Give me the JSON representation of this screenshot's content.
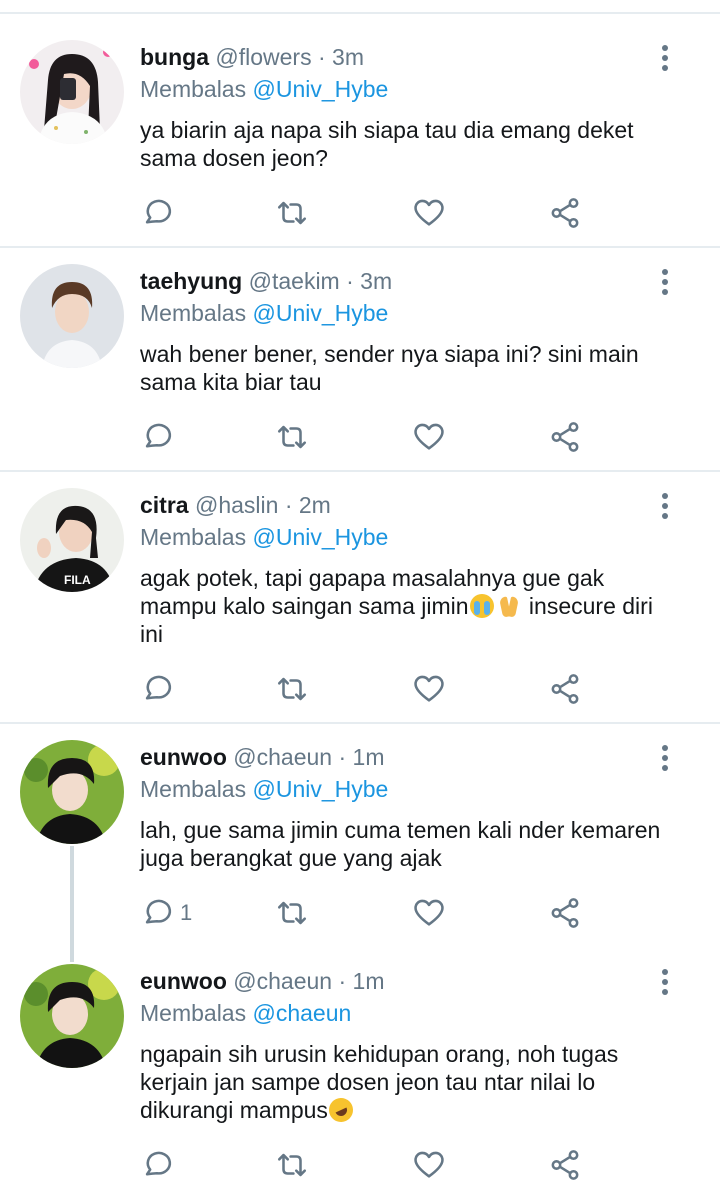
{
  "tweets": [
    {
      "name": "bunga",
      "handle": "@flowers",
      "dot": "·",
      "time": "3m",
      "reply_prefix": "Membalas",
      "reply_to": "@Univ_Hybe",
      "text": "ya biarin aja napa sih siapa tau dia emang deket sama dosen jeon?",
      "reply_count": ""
    },
    {
      "name": "taehyung",
      "handle": "@taekim",
      "dot": "·",
      "time": "3m",
      "reply_prefix": "Membalas",
      "reply_to": "@Univ_Hybe",
      "text": "wah bener bener, sender nya siapa ini? sini main sama kita biar tau",
      "reply_count": ""
    },
    {
      "name": "citra",
      "handle": "@haslin",
      "dot": "·",
      "time": "2m",
      "reply_prefix": "Membalas",
      "reply_to": "@Univ_Hybe",
      "text_before": "agak potek, tapi gapapa masalahnya gue gak mampu kalo saingan sama jimin",
      "text_after": " insecure diri ini",
      "emojis": [
        "loudly-crying-face",
        "folded-hands"
      ],
      "reply_count": ""
    },
    {
      "name": "eunwoo",
      "handle": "@chaeun",
      "dot": "·",
      "time": "1m",
      "reply_prefix": "Membalas",
      "reply_to": "@Univ_Hybe",
      "text": "lah, gue sama jimin cuma temen kali nder kemaren juga berangkat gue yang ajak",
      "reply_count": "1"
    },
    {
      "name": "eunwoo",
      "handle": "@chaeun",
      "dot": "·",
      "time": "1m",
      "reply_prefix": "Membalas",
      "reply_to": "@chaeun",
      "text_before": "ngapain sih urusin kehidupan orang, noh tugas kerjain jan sampe dosen jeon tau ntar nilai lo dikurangi mampus",
      "emojis": [
        "rolling-on-floor-laughing"
      ],
      "reply_count": ""
    }
  ],
  "icons": {
    "reply": "reply-icon",
    "retweet": "retweet-icon",
    "like": "like-icon",
    "share": "share-icon",
    "more": "more-icon"
  },
  "colors": {
    "text": "#14171a",
    "secondary": "#657786",
    "link": "#1b95e0",
    "divider": "#e6ecf0"
  }
}
